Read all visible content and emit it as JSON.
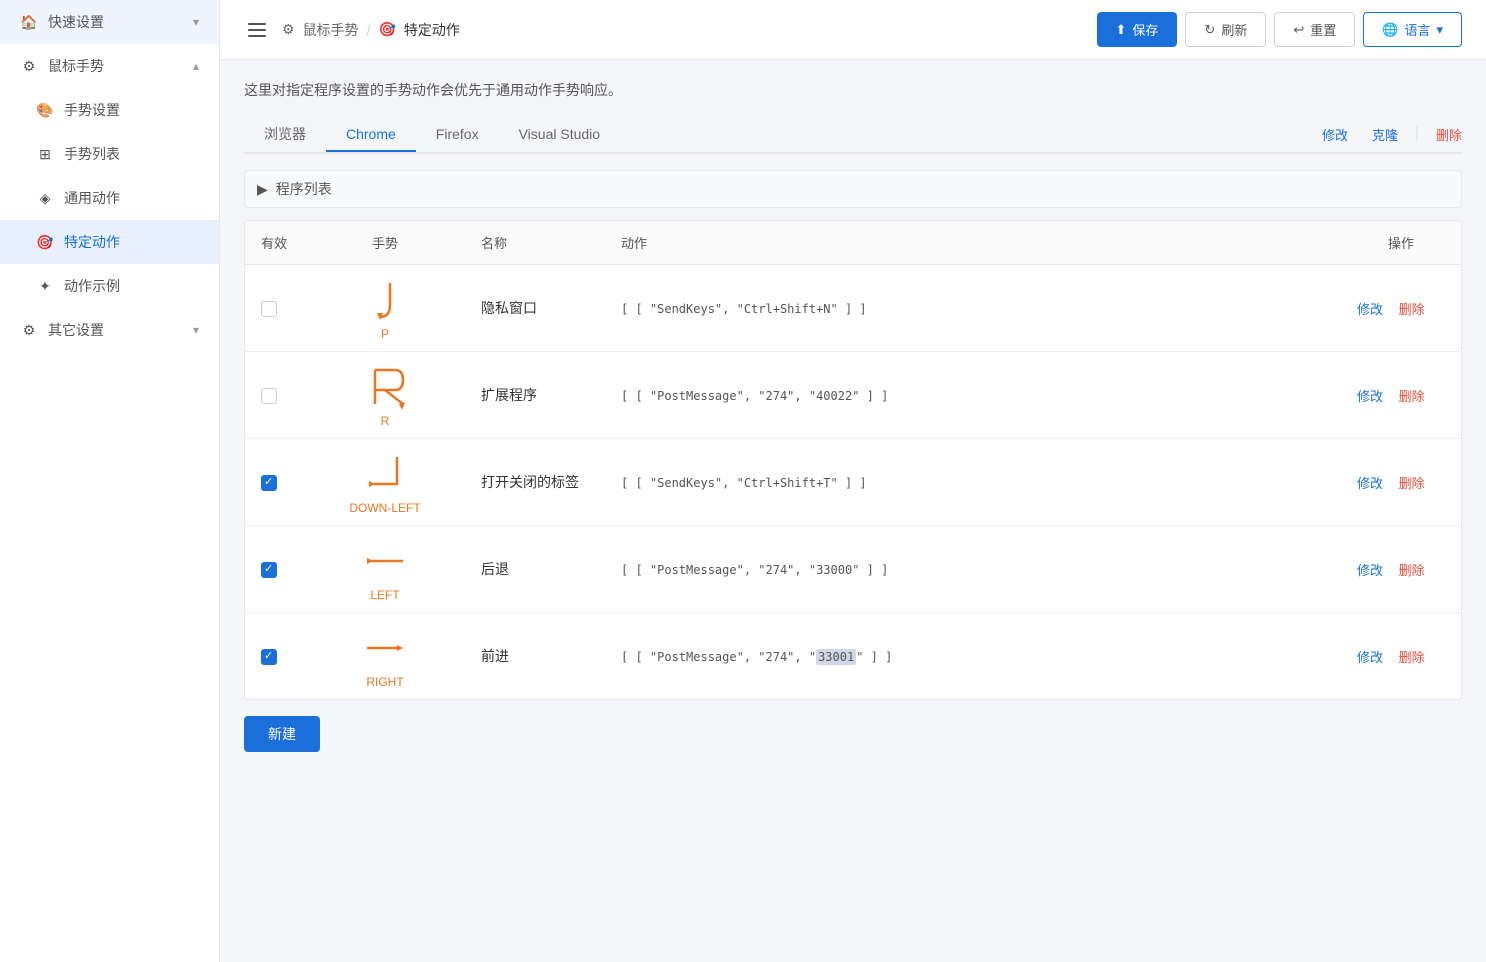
{
  "sidebar": {
    "items": [
      {
        "id": "quick-settings",
        "label": "快速设置",
        "icon": "home",
        "hasChevron": true,
        "chevronDown": true
      },
      {
        "id": "mouse-gesture",
        "label": "鼠标手势",
        "icon": "gear",
        "hasChevron": true,
        "chevronUp": true
      },
      {
        "id": "gesture-settings",
        "label": "手势设置",
        "icon": "palette",
        "hasChevron": false
      },
      {
        "id": "gesture-list",
        "label": "手势列表",
        "icon": "grid",
        "hasChevron": false
      },
      {
        "id": "general-action",
        "label": "通用动作",
        "icon": "cube",
        "hasChevron": false
      },
      {
        "id": "specific-action",
        "label": "特定动作",
        "icon": "camera",
        "hasChevron": false,
        "active": true
      },
      {
        "id": "action-example",
        "label": "动作示例",
        "icon": "bulb",
        "hasChevron": false
      },
      {
        "id": "other-settings",
        "label": "其它设置",
        "icon": "gear2",
        "hasChevron": true,
        "chevronDown": true
      }
    ]
  },
  "header": {
    "menu_label": "☰",
    "breadcrumb_parent": "鼠标手势",
    "breadcrumb_current": "特定动作",
    "parent_icon": "gear",
    "current_icon": "camera",
    "save_label": "保存",
    "refresh_label": "刷新",
    "reset_label": "重置",
    "language_label": "语言"
  },
  "main": {
    "description": "这里对指定程序设置的手势动作会优先于通用动作手势响应。",
    "tabs": [
      {
        "id": "browser",
        "label": "浏览器",
        "active": false
      },
      {
        "id": "chrome",
        "label": "Chrome",
        "active": true
      },
      {
        "id": "firefox",
        "label": "Firefox",
        "active": false
      },
      {
        "id": "visual-studio",
        "label": "Visual Studio",
        "active": false
      }
    ],
    "tab_actions": {
      "edit": "修改",
      "clone": "克隆",
      "delete": "删除"
    },
    "program_section": {
      "label": "程序列表"
    },
    "table": {
      "headers": {
        "valid": "有效",
        "gesture": "手势",
        "name": "名称",
        "action": "动作",
        "operation": "操作"
      },
      "rows": [
        {
          "id": 1,
          "checked": false,
          "gesture_type": "P",
          "gesture_label": "P",
          "name": "隐私窗口",
          "action": "[ [ \"SendKeys\", \"Ctrl+Shift+N\" ] ]",
          "edit_label": "修改",
          "delete_label": "删除"
        },
        {
          "id": 2,
          "checked": false,
          "gesture_type": "R",
          "gesture_label": "R",
          "name": "扩展程序",
          "action": "[ [ \"PostMessage\", \"274\", \"40022\" ] ]",
          "edit_label": "修改",
          "delete_label": "删除"
        },
        {
          "id": 3,
          "checked": true,
          "gesture_type": "DOWN-LEFT",
          "gesture_label": "DOWN-LEFT",
          "name": "打开关闭的标签",
          "action": "[ [ \"SendKeys\", \"Ctrl+Shift+T\" ] ]",
          "edit_label": "修改",
          "delete_label": "删除"
        },
        {
          "id": 4,
          "checked": true,
          "gesture_type": "LEFT",
          "gesture_label": "LEFT",
          "name": "后退",
          "action": "[ [ \"PostMessage\", \"274\", \"33000\" ] ]",
          "edit_label": "修改",
          "delete_label": "删除"
        },
        {
          "id": 5,
          "checked": true,
          "gesture_type": "RIGHT",
          "gesture_label": "RIGHT",
          "name": "前进",
          "action": "[ [ \"PostMessage\", \"274\", \"33001\" ] ]",
          "action_highlight": "33001",
          "edit_label": "修改",
          "delete_label": "删除"
        }
      ]
    },
    "new_button_label": "新建"
  }
}
